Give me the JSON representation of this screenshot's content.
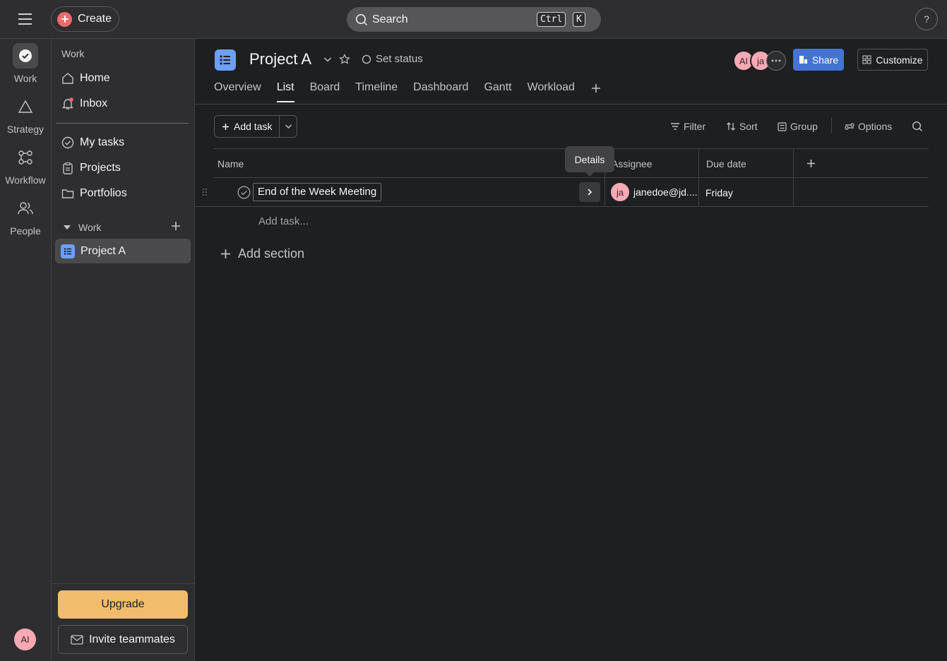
{
  "topbar": {
    "create_label": "Create",
    "search_placeholder": "Search",
    "shortcut_ctrl": "Ctrl",
    "shortcut_key": "K",
    "help_label": "?"
  },
  "rail": {
    "items": [
      {
        "label": "Work",
        "icon": "check-circle-icon"
      },
      {
        "label": "Strategy",
        "icon": "triangle-icon"
      },
      {
        "label": "Workflow",
        "icon": "workflow-icon"
      },
      {
        "label": "People",
        "icon": "people-icon"
      }
    ],
    "user_initials": "AI"
  },
  "sidebar": {
    "heading": "Work",
    "top_items": [
      {
        "label": "Home",
        "icon": "home-icon"
      },
      {
        "label": "Inbox",
        "icon": "bell-icon"
      }
    ],
    "nav_items": [
      {
        "label": "My tasks",
        "icon": "check-circle-icon"
      },
      {
        "label": "Projects",
        "icon": "clipboard-icon"
      },
      {
        "label": "Portfolios",
        "icon": "folder-icon"
      }
    ],
    "section_label": "Work",
    "project_item": "Project A",
    "upgrade_label": "Upgrade",
    "invite_label": "Invite teammates"
  },
  "project": {
    "title": "Project A",
    "set_status": "Set status",
    "members": [
      "AI",
      "ja"
    ],
    "share_label": "Share",
    "customize_label": "Customize",
    "tabs": [
      "Overview",
      "List",
      "Board",
      "Timeline",
      "Dashboard",
      "Gantt",
      "Workload"
    ],
    "active_tab": "List"
  },
  "toolbar": {
    "add_task": "Add task",
    "filter": "Filter",
    "sort": "Sort",
    "group": "Group",
    "options": "Options"
  },
  "table": {
    "columns": [
      "Name",
      "Assignee",
      "Due date"
    ],
    "rows": [
      {
        "name": "End of the Week Meeting",
        "assignee_initials": "ja",
        "assignee": "janedoe@jd....",
        "due": "Friday"
      }
    ],
    "tooltip": "Details",
    "add_task_placeholder": "Add task...",
    "add_section": "Add section"
  },
  "colors": {
    "accent_blue": "#4573d2",
    "create_red": "#f06a6a",
    "upgrade": "#f1bd6c",
    "avatar_pink": "#f8a9b6"
  }
}
